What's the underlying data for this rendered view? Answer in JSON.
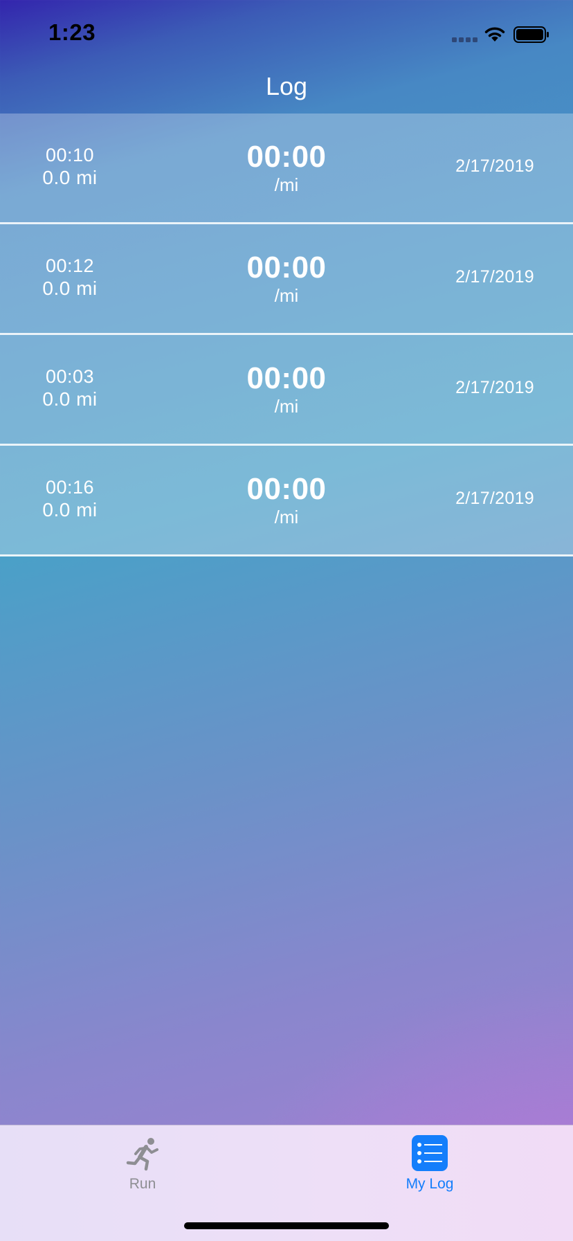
{
  "status_bar": {
    "time": "1:23"
  },
  "nav": {
    "title": "Log"
  },
  "log_entries": [
    {
      "duration": "00:10",
      "distance": "0.0 mi",
      "pace": "00:00",
      "pace_unit": "/mi",
      "date": "2/17/2019"
    },
    {
      "duration": "00:12",
      "distance": "0.0 mi",
      "pace": "00:00",
      "pace_unit": "/mi",
      "date": "2/17/2019"
    },
    {
      "duration": "00:03",
      "distance": "0.0 mi",
      "pace": "00:00",
      "pace_unit": "/mi",
      "date": "2/17/2019"
    },
    {
      "duration": "00:16",
      "distance": "0.0 mi",
      "pace": "00:00",
      "pace_unit": "/mi",
      "date": "2/17/2019"
    }
  ],
  "tab_bar": {
    "tabs": [
      {
        "label": "Run",
        "icon": "runner-icon",
        "selected": false
      },
      {
        "label": "My Log",
        "icon": "list-icon",
        "selected": true
      }
    ]
  },
  "colors": {
    "tab_active": "#147efb",
    "tab_inactive": "#8e8e93",
    "background_top": "#3325ad",
    "background_middle": "#4aa0c8",
    "background_bottom": "#a67fd3"
  }
}
